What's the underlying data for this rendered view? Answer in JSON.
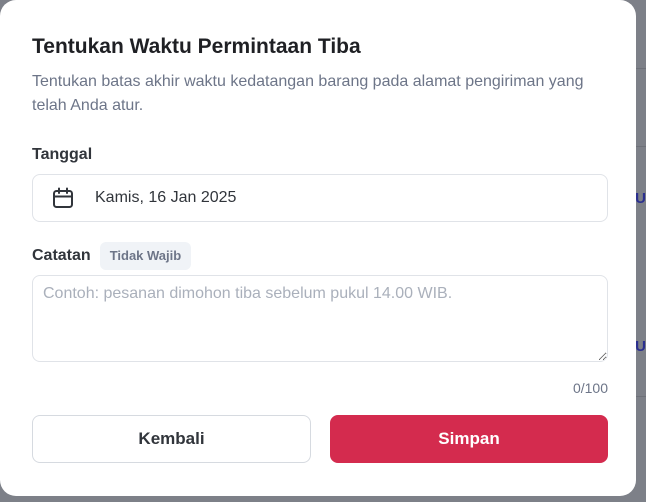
{
  "dialog": {
    "title": "Tentukan Waktu Permintaan Tiba",
    "subtitle": "Tentukan batas akhir waktu kedatangan barang pada alamat pengiriman yang telah Anda atur.",
    "date_label": "Tanggal",
    "date_icon": "calendar-icon",
    "date_value": "Kamis, 16 Jan 2025",
    "note_label": "Catatan",
    "note_badge": "Tidak Wajib",
    "note_placeholder": "Contoh: pesanan dimohon tiba sebelum pukul 14.00 WIB.",
    "note_value": "",
    "char_counter": "0/100",
    "back_button": "Kembali",
    "save_button": "Simpan"
  },
  "colors": {
    "primary": "#d42b4e",
    "text": "#31353b",
    "muted": "#6d7588",
    "border": "#e0e3e8"
  }
}
